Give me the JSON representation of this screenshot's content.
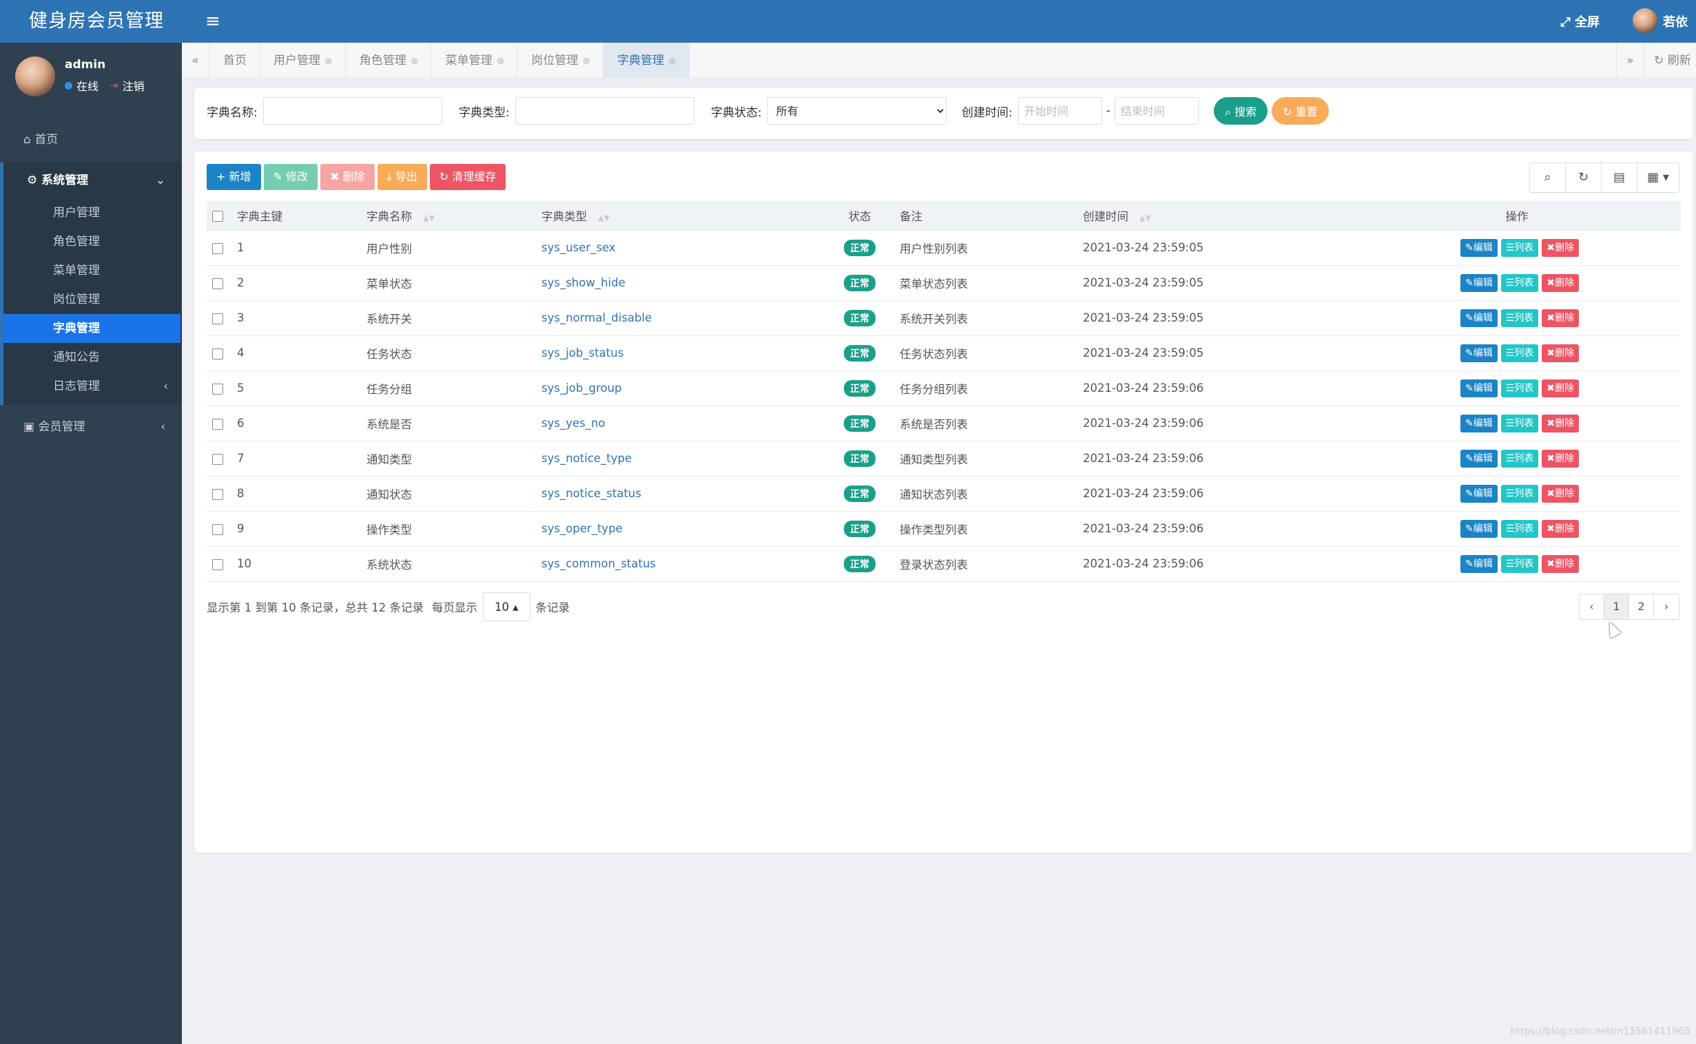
{
  "app": {
    "title": "健身房会员管理"
  },
  "user": {
    "name": "admin",
    "status": "在线",
    "signout": "注销"
  },
  "topbar": {
    "fullscreen": "全屏",
    "username": "若依"
  },
  "sidebar": {
    "home": "首页",
    "system_group": "系统管理",
    "system_items": [
      "用户管理",
      "角色管理",
      "菜单管理",
      "岗位管理",
      "字典管理",
      "通知公告",
      "日志管理"
    ],
    "member_group": "会员管理"
  },
  "tabs": [
    "首页",
    "用户管理",
    "角色管理",
    "菜单管理",
    "岗位管理",
    "字典管理"
  ],
  "tab_refresh": "刷新",
  "search": {
    "name_label": "字典名称:",
    "type_label": "字典类型:",
    "status_label": "字典状态:",
    "status_value": "所有",
    "time_label": "创建时间:",
    "start_placeholder": "开始时间",
    "separator": "-",
    "end_placeholder": "结束时间",
    "search_btn": "搜索",
    "reset_btn": "重置"
  },
  "toolbar": {
    "add": "新增",
    "edit": "修改",
    "delete": "删除",
    "export": "导出",
    "clear_cache": "清理缓存"
  },
  "table": {
    "headers": [
      "字典主键",
      "字典名称",
      "字典类型",
      "状态",
      "备注",
      "创建时间",
      "操作"
    ],
    "rows": [
      {
        "id": "1",
        "name": "用户性别",
        "type": "sys_user_sex",
        "status": "正常",
        "remark": "用户性别列表",
        "time": "2021-03-24 23:59:05"
      },
      {
        "id": "2",
        "name": "菜单状态",
        "type": "sys_show_hide",
        "status": "正常",
        "remark": "菜单状态列表",
        "time": "2021-03-24 23:59:05"
      },
      {
        "id": "3",
        "name": "系统开关",
        "type": "sys_normal_disable",
        "status": "正常",
        "remark": "系统开关列表",
        "time": "2021-03-24 23:59:05"
      },
      {
        "id": "4",
        "name": "任务状态",
        "type": "sys_job_status",
        "status": "正常",
        "remark": "任务状态列表",
        "time": "2021-03-24 23:59:05"
      },
      {
        "id": "5",
        "name": "任务分组",
        "type": "sys_job_group",
        "status": "正常",
        "remark": "任务分组列表",
        "time": "2021-03-24 23:59:06"
      },
      {
        "id": "6",
        "name": "系统是否",
        "type": "sys_yes_no",
        "status": "正常",
        "remark": "系统是否列表",
        "time": "2021-03-24 23:59:06"
      },
      {
        "id": "7",
        "name": "通知类型",
        "type": "sys_notice_type",
        "status": "正常",
        "remark": "通知类型列表",
        "time": "2021-03-24 23:59:06"
      },
      {
        "id": "8",
        "name": "通知状态",
        "type": "sys_notice_status",
        "status": "正常",
        "remark": "通知状态列表",
        "time": "2021-03-24 23:59:06"
      },
      {
        "id": "9",
        "name": "操作类型",
        "type": "sys_oper_type",
        "status": "正常",
        "remark": "操作类型列表",
        "time": "2021-03-24 23:59:06"
      },
      {
        "id": "10",
        "name": "系统状态",
        "type": "sys_common_status",
        "status": "正常",
        "remark": "登录状态列表",
        "time": "2021-03-24 23:59:06"
      }
    ],
    "op_edit": "编辑",
    "op_list": "列表",
    "op_delete": "删除"
  },
  "pagination": {
    "summary": "显示第 1 到第 10 条记录，总共 12 条记录",
    "per_page_label": "每页显示",
    "per_page_value": "10",
    "records_label": "条记录",
    "prev": "‹",
    "pages": [
      "1",
      "2"
    ],
    "next": "›"
  },
  "watermark": "https://blog.csdn.net/m13561411965",
  "colors": {
    "brand": "#2e74b5",
    "sidebar": "#2f4050",
    "active": "#1a73e8",
    "success": "#1aa08a",
    "warning": "#f8ac59",
    "danger": "#ed5565",
    "info": "#23c6c8"
  }
}
